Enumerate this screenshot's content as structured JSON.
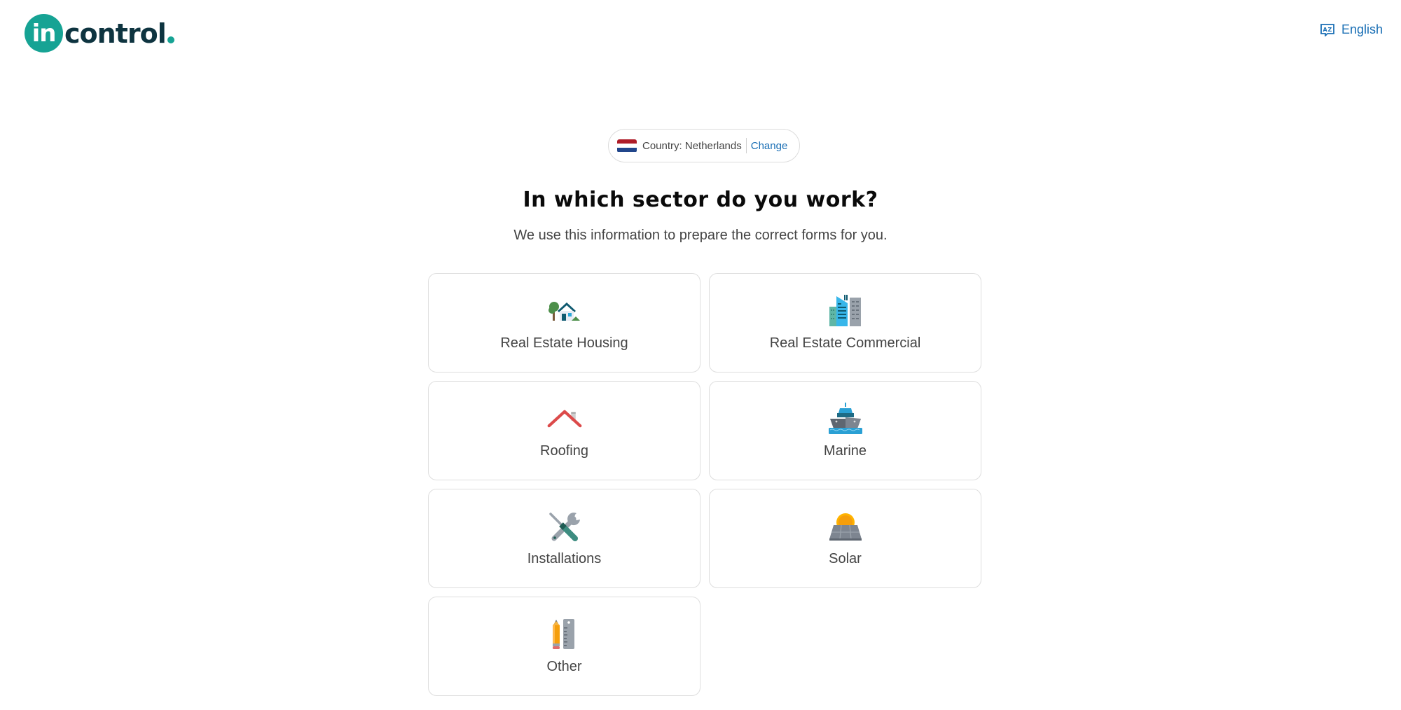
{
  "header": {
    "logo_badge": "in",
    "logo_word": "control",
    "language_label": "English",
    "language_icon": "translate-icon"
  },
  "country": {
    "label": "Country: Netherlands",
    "change_label": "Change",
    "flag_icon": "netherlands-flag-icon",
    "flag_colors": [
      "#ae1c28",
      "#ffffff",
      "#21468b"
    ]
  },
  "title": "In which sector do you work?",
  "subtitle": "We use this information to prepare the correct forms for you.",
  "sectors": [
    {
      "label": "Real Estate Housing",
      "icon": "house-icon"
    },
    {
      "label": "Real Estate Commercial",
      "icon": "office-building-icon"
    },
    {
      "label": "Roofing",
      "icon": "roof-icon"
    },
    {
      "label": "Marine",
      "icon": "ship-icon"
    },
    {
      "label": "Installations",
      "icon": "tools-icon"
    },
    {
      "label": "Solar",
      "icon": "solar-panel-icon"
    },
    {
      "label": "Other",
      "icon": "pencil-ruler-icon"
    }
  ],
  "colors": {
    "brand": "#16a394",
    "brand_dark": "#0e3440",
    "link": "#1a6fb5"
  }
}
